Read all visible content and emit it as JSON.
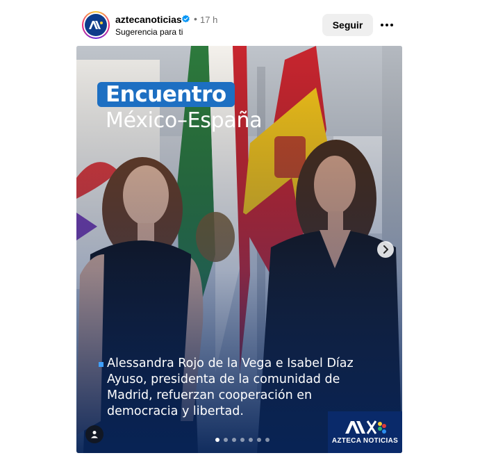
{
  "post": {
    "username": "aztecanoticias",
    "time": "17 h",
    "suggestion": "Sugerencia para ti",
    "follow_label": "Seguir"
  },
  "media": {
    "headline_1": "Encuentro",
    "headline_2": "México–España",
    "caption": "Alessandra Rojo de la Vega e Isabel Díaz Ayuso, presidenta de la comunidad de Madrid, refuerzan cooperación en democracia y libertad.",
    "brand_text": "AZTECA NOTICIAS",
    "slide_count": 7,
    "active_slide": 1
  },
  "colors": {
    "accent_blue": "#1d6fc2",
    "verified_blue": "#0095f6",
    "brand_navy": "#0a2a6a"
  },
  "icons": [
    "verified-badge-icon",
    "more-options-icon",
    "chevron-right-icon",
    "user-tag-icon"
  ]
}
